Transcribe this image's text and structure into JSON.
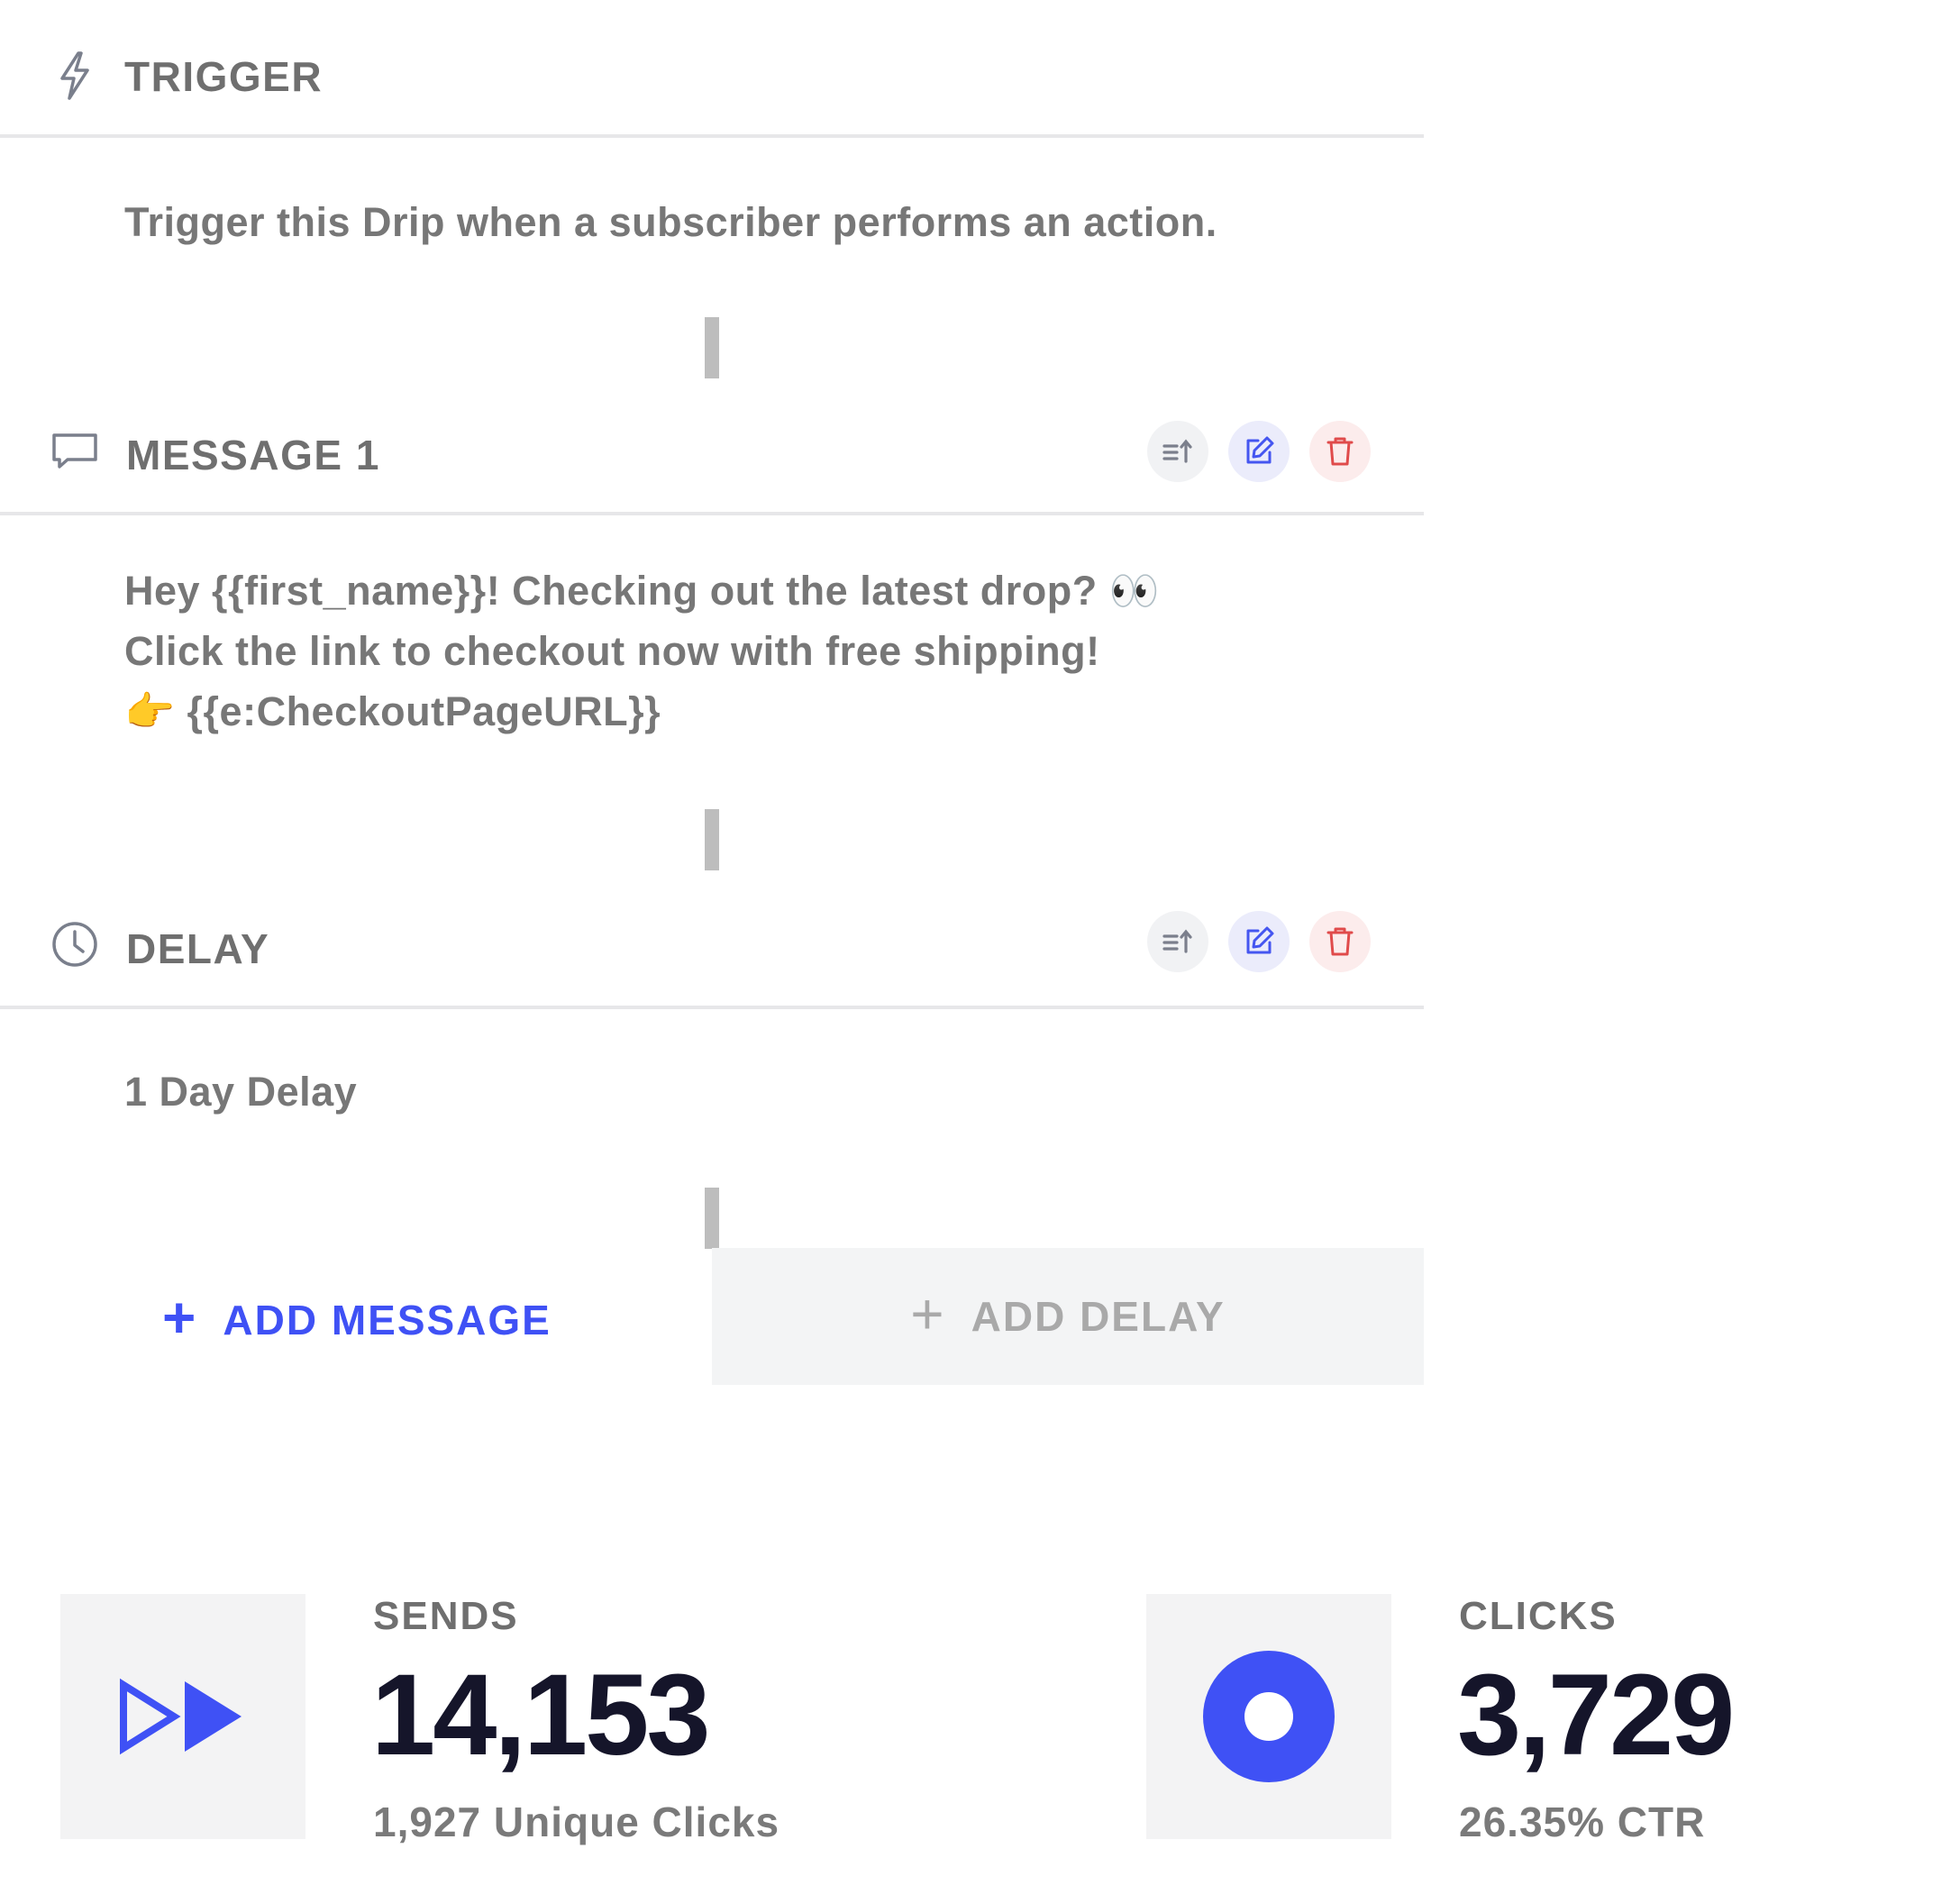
{
  "trigger": {
    "title": "TRIGGER",
    "icon": "lightning-icon",
    "description": "Trigger this Drip when a subscriber performs an action."
  },
  "message1": {
    "title": "MESSAGE 1",
    "icon": "message-icon",
    "lines": [
      "Hey {{first_name}}! Checking out the latest drop? 👀",
      "Click the link to checkout now with free shipping!",
      "👉 {{e:CheckoutPageURL}}"
    ]
  },
  "delay": {
    "title": "DELAY",
    "icon": "clock-icon",
    "description": "1 Day Delay"
  },
  "actions": {
    "reorder_icon": "reorder-icon",
    "edit_icon": "edit-icon",
    "delete_icon": "trash-icon"
  },
  "add": {
    "message_label": "ADD MESSAGE",
    "delay_label": "ADD DELAY",
    "plus": "+"
  },
  "stats": {
    "sends": {
      "label": "SENDS",
      "value": "14,153",
      "sub": "1,927 Unique Clicks",
      "icon": "fast-forward-icon"
    },
    "clicks": {
      "label": "CLICKS",
      "value": "3,729",
      "sub": "26.35% CTR",
      "icon": "target-circle-icon"
    }
  },
  "colors": {
    "accent": "#3f51f5",
    "danger": "#e04b4b",
    "text_muted": "#6f6f6f",
    "value_dark": "#15152a",
    "box_bg": "#f3f3f4"
  }
}
